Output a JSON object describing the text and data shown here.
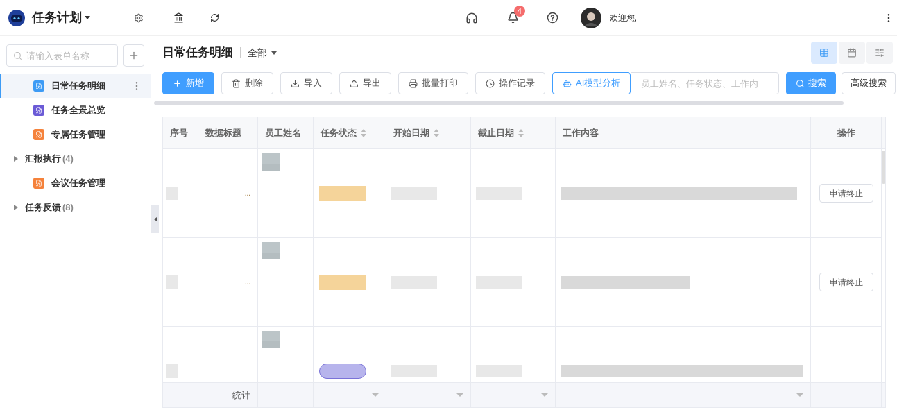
{
  "app": {
    "title": "任务计划"
  },
  "sidebar": {
    "search": {
      "placeholder": "请输入表单名称"
    },
    "items": [
      {
        "kind": "form",
        "label": "日常任务明细",
        "color": "#3d9bf5",
        "selected": true
      },
      {
        "kind": "form",
        "label": "任务全景总览",
        "color": "#6b5bd6",
        "selected": false
      },
      {
        "kind": "form",
        "label": "专属任务管理",
        "color": "#f5823b",
        "selected": false
      },
      {
        "kind": "group",
        "label": "汇报执行",
        "count": "(4)",
        "expanded": false,
        "selected": false
      },
      {
        "kind": "form",
        "label": "会议任务管理",
        "color": "#f5823b",
        "selected": false
      },
      {
        "kind": "group",
        "label": "任务反馈",
        "count": "(8)",
        "expanded": false,
        "selected": false
      }
    ]
  },
  "topbar": {
    "notification_count": "4",
    "greeting": "欢迎您,"
  },
  "page": {
    "title": "日常任务明细",
    "filter": "全部",
    "views": [
      {
        "kind": "table",
        "selected": true
      },
      {
        "kind": "calendar",
        "selected": false
      },
      {
        "kind": "settings",
        "selected": false
      }
    ]
  },
  "toolbar": {
    "buttons": [
      {
        "kind": "primary",
        "label": "新增"
      },
      {
        "kind": "default",
        "label": "删除"
      },
      {
        "kind": "default",
        "label": "导入"
      },
      {
        "kind": "default",
        "label": "导出"
      },
      {
        "kind": "default",
        "label": "批量打印"
      },
      {
        "kind": "default",
        "label": "操作记录"
      },
      {
        "kind": "outline",
        "label": "AI模型分析"
      }
    ],
    "search": {
      "placeholder": "员工姓名、任务状态、工作内"
    },
    "search_button": "搜索",
    "advanced_button": "高级搜索"
  },
  "table": {
    "columns": [
      {
        "label": "序号",
        "sortable": false,
        "summary_dropdown": false
      },
      {
        "label": "数据标题",
        "sortable": false,
        "summary_dropdown": false
      },
      {
        "label": "员工姓名",
        "sortable": false,
        "summary_dropdown": false
      },
      {
        "label": "任务状态",
        "sortable": true,
        "summary_dropdown": true
      },
      {
        "label": "开始日期",
        "sortable": true,
        "summary_dropdown": true
      },
      {
        "label": "截止日期",
        "sortable": true,
        "summary_dropdown": true
      },
      {
        "label": "工作内容",
        "sortable": false,
        "summary_dropdown": true
      },
      {
        "label": "操作",
        "sortable": false,
        "summary_dropdown": false
      }
    ],
    "rows": [
      {
        "title": "...",
        "color": "#f5d49a",
        "action": "申请终止"
      },
      {
        "title": "...",
        "color": "#f5d49a",
        "action": "申请终止"
      },
      {
        "color": "#b7b4ec"
      }
    ],
    "footer": {
      "label": "统计"
    }
  }
}
